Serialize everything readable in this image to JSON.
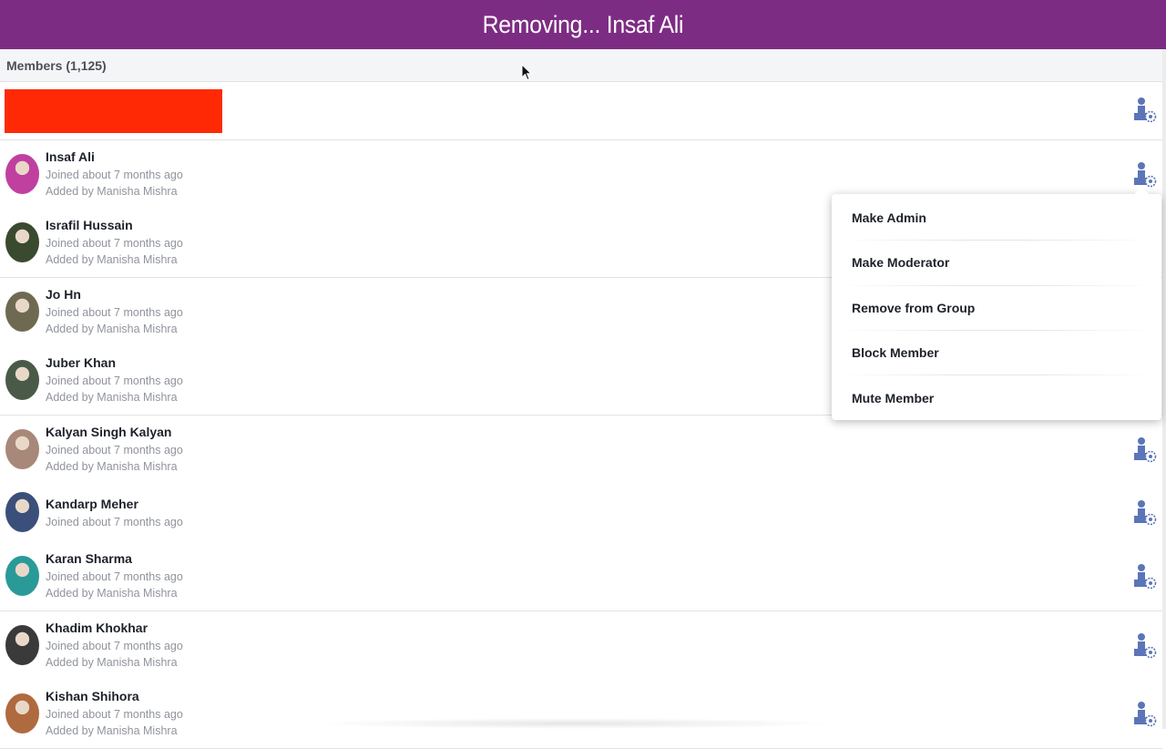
{
  "topbar": {
    "title": "Removing... Insaf Ali"
  },
  "members": {
    "title": "Members (1,125)"
  },
  "rows": [
    {
      "name": "Insaf Ali",
      "joined": "Joined about 7 months ago",
      "added": "Added by Manisha Mishra",
      "avatar_color": "#c040a0"
    },
    {
      "name": "Israfil Hussain",
      "joined": "Joined about 7 months ago",
      "added": "Added by Manisha Mishra",
      "avatar_color": "#3a4a2e"
    },
    {
      "name": "Jo Hn",
      "joined": "Joined about 7 months ago",
      "added": "Added by Manisha Mishra",
      "avatar_color": "#6e6a52"
    },
    {
      "name": "Juber Khan",
      "joined": "Joined about 7 months ago",
      "added": "Added by Manisha Mishra",
      "avatar_color": "#4a5a48"
    },
    {
      "name": "Kalyan Singh Kalyan",
      "joined": "Joined about 7 months ago",
      "added": "Added by Manisha Mishra",
      "avatar_color": "#a88878"
    },
    {
      "name": "Kandarp Meher",
      "joined": "Joined about 7 months ago",
      "added": "",
      "avatar_color": "#3a4f7a"
    },
    {
      "name": "Karan Sharma",
      "joined": "Joined about 7 months ago",
      "added": "Added by Manisha Mishra",
      "avatar_color": "#2a9a98"
    },
    {
      "name": "Khadim Khokhar",
      "joined": "Joined about 7 months ago",
      "added": "Added by Manisha Mishra",
      "avatar_color": "#3a3a3a"
    },
    {
      "name": "Kishan Shihora",
      "joined": "Joined about 7 months ago",
      "added": "Added by Manisha Mishra",
      "avatar_color": "#b06a40"
    }
  ],
  "menu": {
    "items": [
      "Make Admin",
      "Make Moderator",
      "Remove from Group",
      "Block Member",
      "Mute Member"
    ]
  },
  "icons": {
    "row_action": "admin-settings-icon",
    "cursor": "mouse-pointer-icon"
  },
  "colors": {
    "topbar": "#7d2c83",
    "highlight": "#ff2a05",
    "gear": "#5b75b8"
  }
}
